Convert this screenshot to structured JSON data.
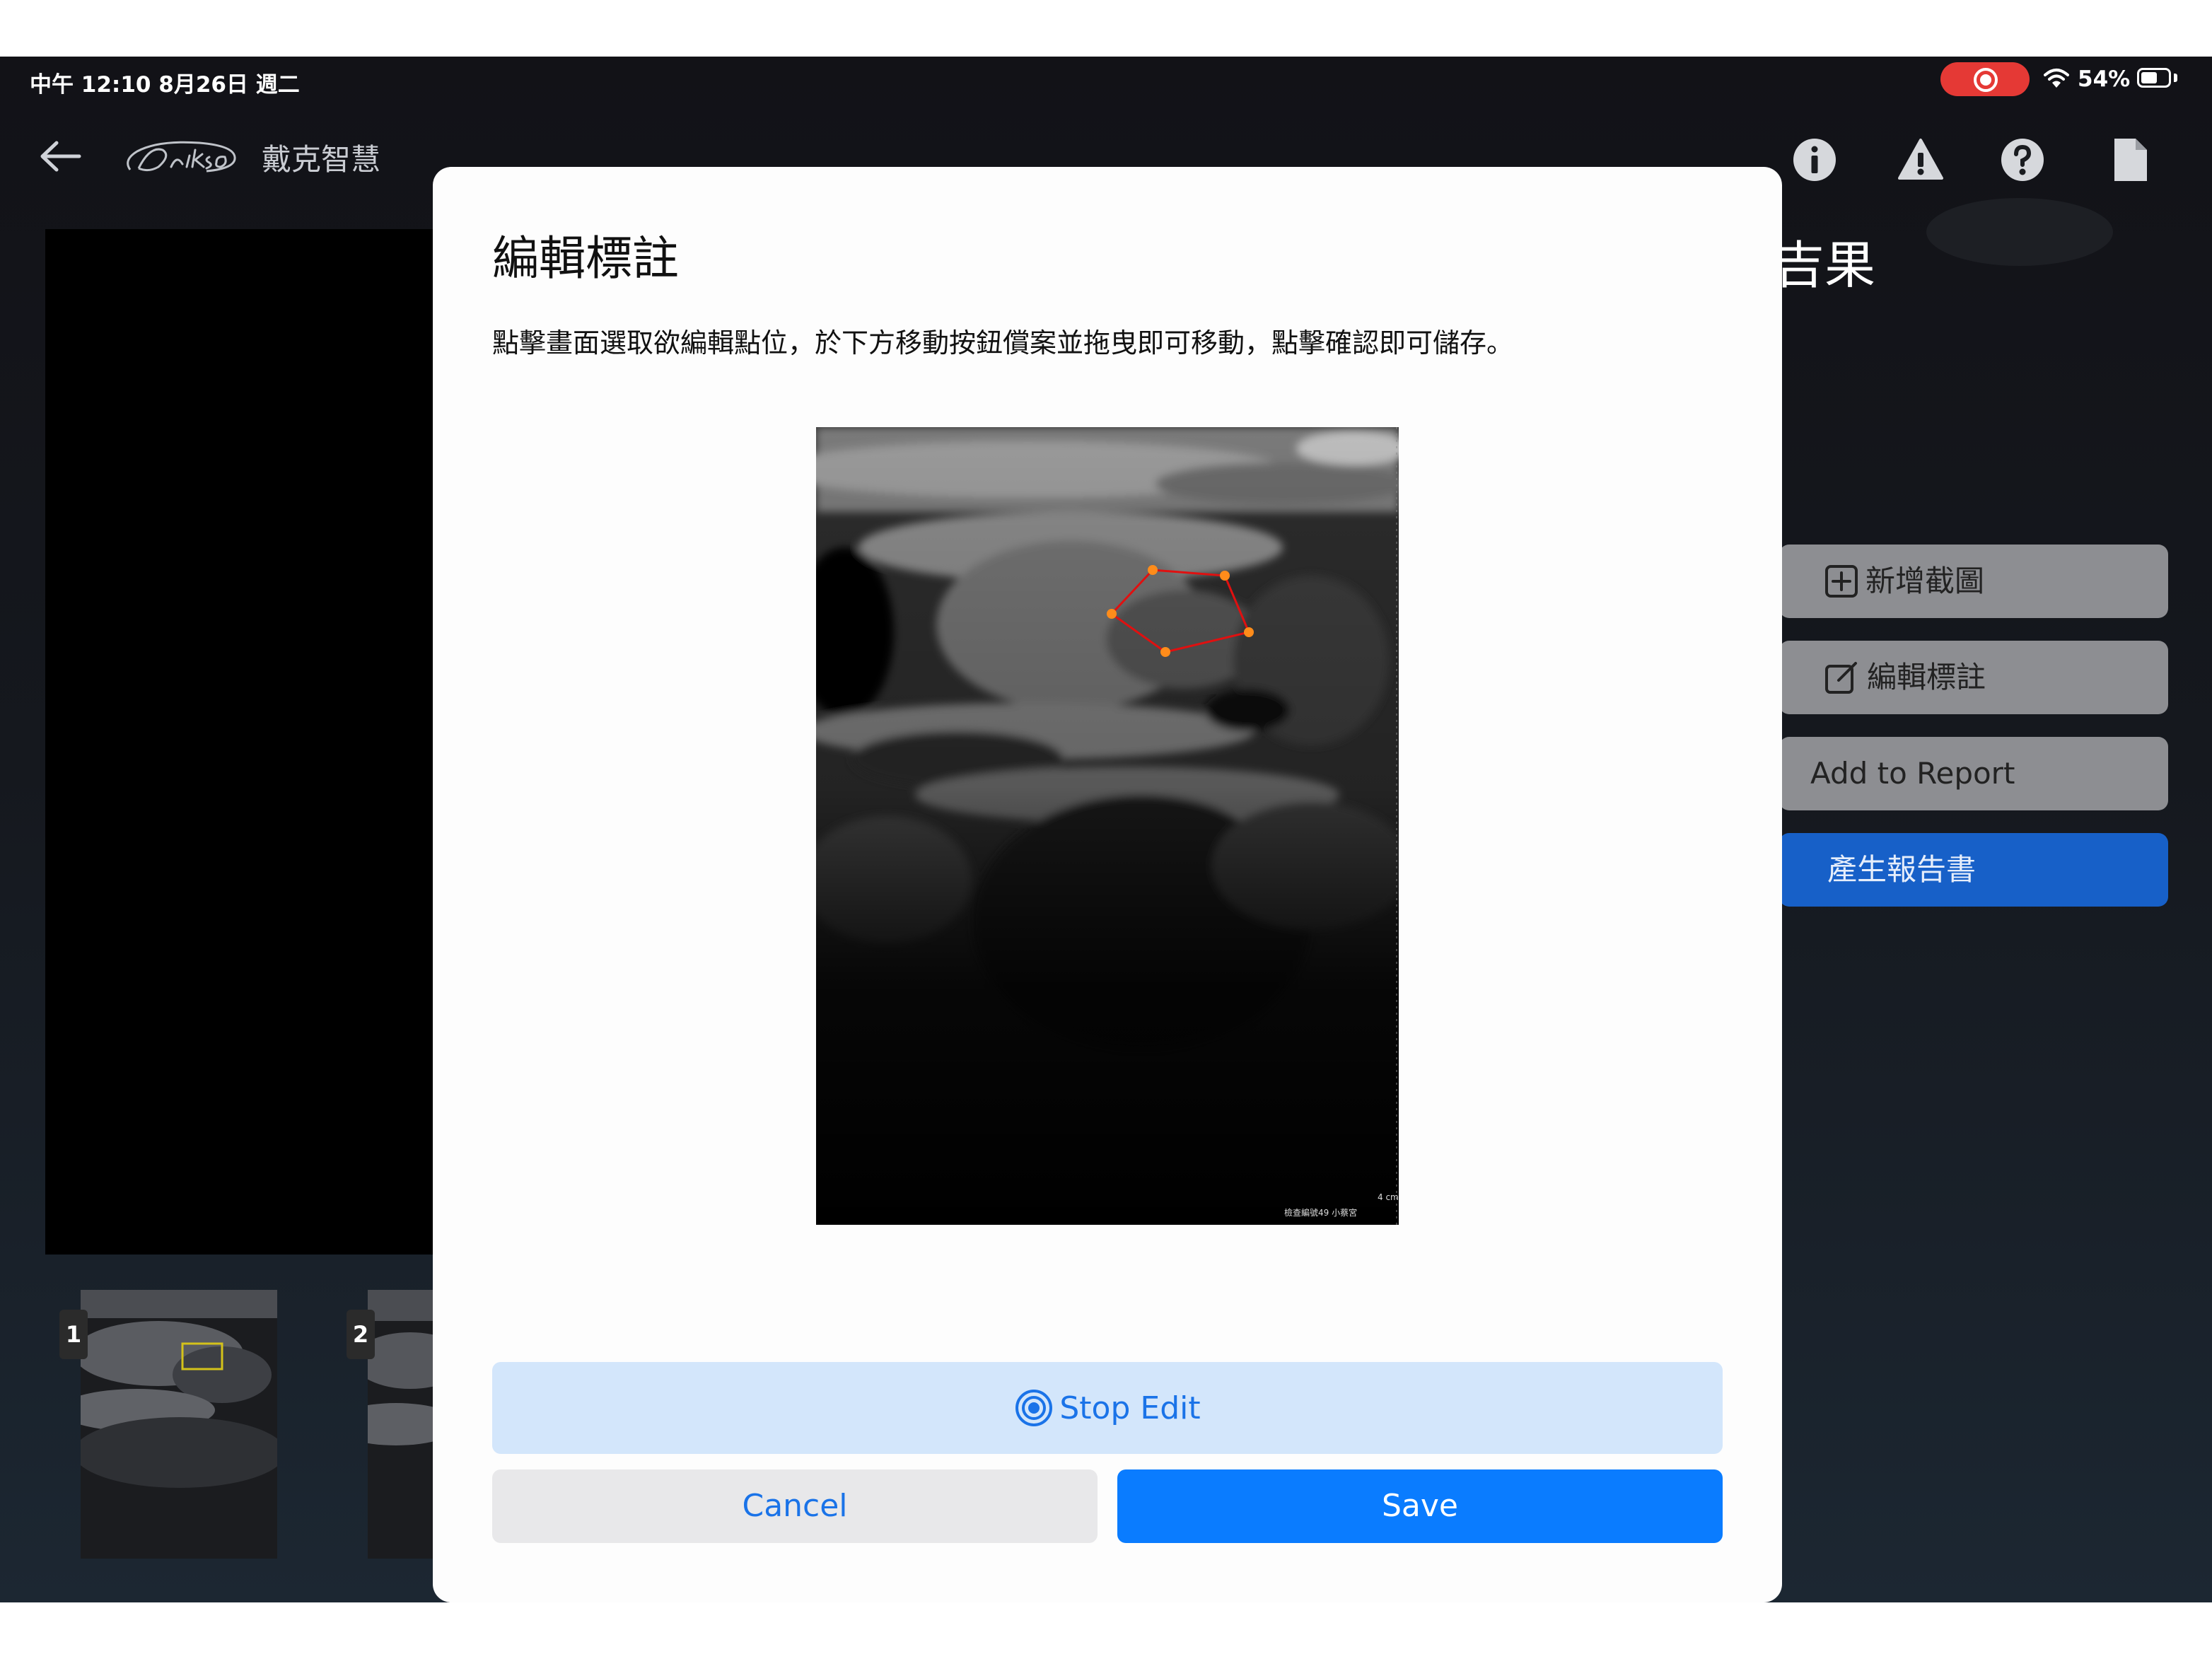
{
  "status_bar": {
    "time": "中午 12:10   8月26日 週二",
    "battery": "54%"
  },
  "header": {
    "brand_name": "戴克智慧"
  },
  "background_page": {
    "result_title_partial": "吉果",
    "thumbnails": [
      "1",
      "2"
    ],
    "actions": {
      "add_screenshot": "新增截圖",
      "edit_annotation": "編輯標註",
      "add_to_report": "Add to Report",
      "generate_report": "產生報告書"
    }
  },
  "modal": {
    "title": "編輯標註",
    "description": "點擊畫面選取欲編輯點位，於下方移動按鈕償案並拖曳即可移動，點擊確認即可儲存。",
    "image_overlay_text": "檢查編號49  小蔡宮",
    "image_scale_label": "4 cm",
    "stop_edit_label": "Stop Edit",
    "cancel_label": "Cancel",
    "save_label": "Save"
  },
  "colors": {
    "accent_blue": "#0a7cff",
    "stop_edit_bg": "#d3e6fb",
    "annotation_line": "#e01010",
    "annotation_point": "#ff8c1a",
    "recording_pill": "#e53935",
    "report_button": "#1760c8"
  }
}
